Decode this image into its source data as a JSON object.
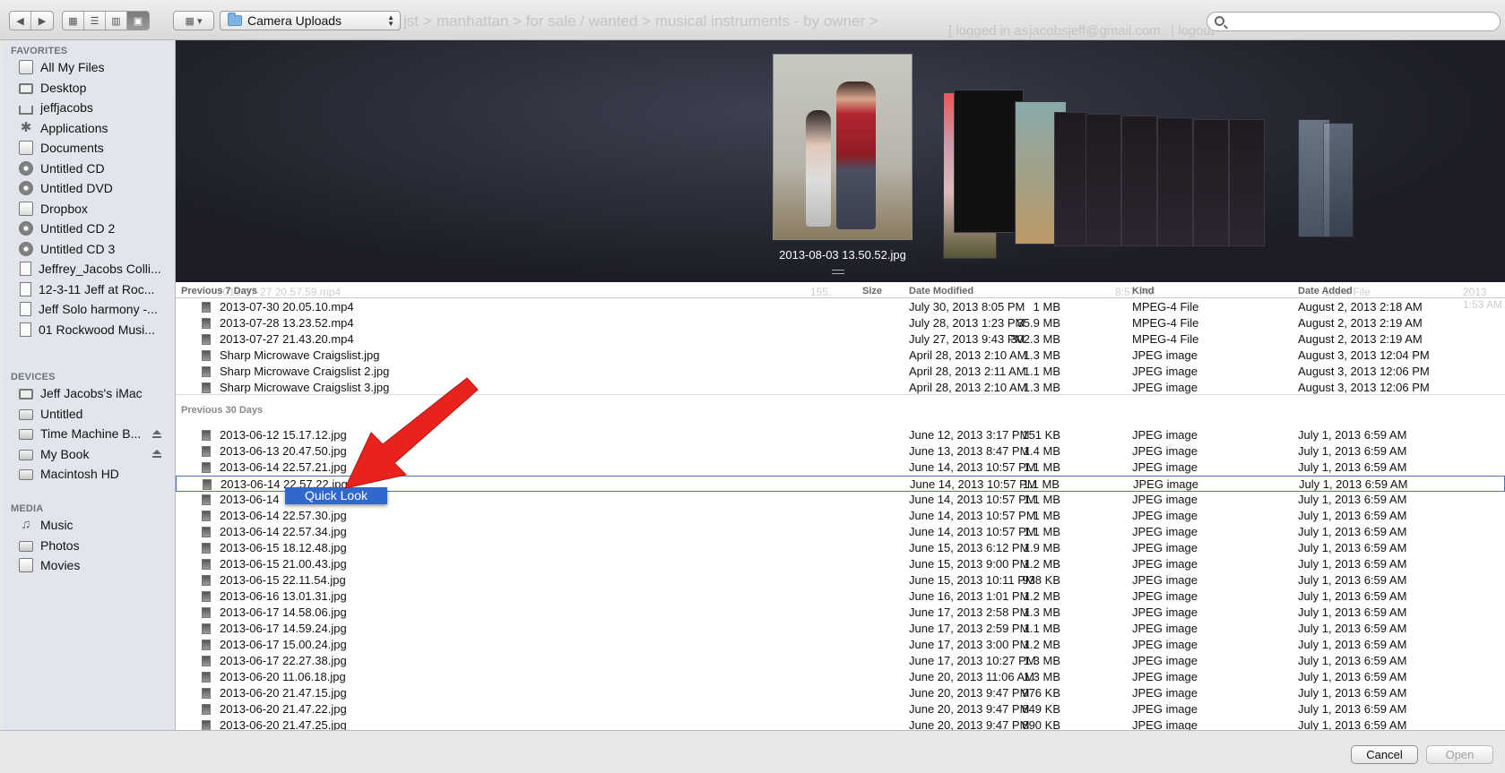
{
  "toolbar": {
    "location": "Camera Uploads",
    "search_placeholder": "",
    "ghost_breadcrumb": "manhattan > for sale / wanted > musical instruments - by owner >",
    "ghost_breadcrumb_head": "jst >",
    "ghost_login": "[ logged in as",
    "ghost_email": "jacobsjeff@gmail.com",
    "ghost_logout": "| logout"
  },
  "sidebar": {
    "favorites_label": "FAVORITES",
    "favorites": [
      {
        "label": "All My Files",
        "icon": "all-files-icon"
      },
      {
        "label": "Desktop",
        "icon": "desktop-icon"
      },
      {
        "label": "jeffjacobs",
        "icon": "home-icon"
      },
      {
        "label": "Applications",
        "icon": "applications-icon"
      },
      {
        "label": "Documents",
        "icon": "documents-icon"
      },
      {
        "label": "Untitled CD",
        "icon": "cd-icon"
      },
      {
        "label": "Untitled DVD",
        "icon": "cd-icon"
      },
      {
        "label": "Dropbox",
        "icon": "folder-icon"
      },
      {
        "label": "Untitled CD 2",
        "icon": "cd-icon"
      },
      {
        "label": "Untitled CD 3",
        "icon": "cd-icon"
      },
      {
        "label": "Jeffrey_Jacobs Colli...",
        "icon": "document-icon"
      },
      {
        "label": "12-3-11 Jeff at Roc...",
        "icon": "document-icon"
      },
      {
        "label": "Jeff Solo harmony -...",
        "icon": "document-icon"
      },
      {
        "label": "01 Rockwood Musi...",
        "icon": "document-icon"
      }
    ],
    "devices_label": "DEVICES",
    "devices": [
      {
        "label": "Jeff Jacobs's iMac",
        "icon": "imac-icon",
        "eject": false
      },
      {
        "label": "Untitled",
        "icon": "drive-icon",
        "eject": false
      },
      {
        "label": "Time Machine B...",
        "icon": "drive-icon",
        "eject": true
      },
      {
        "label": "My Book",
        "icon": "drive-icon",
        "eject": true
      },
      {
        "label": "Macintosh HD",
        "icon": "drive-icon",
        "eject": false
      }
    ],
    "media_label": "MEDIA",
    "media": [
      {
        "label": "Music",
        "icon": "music-icon"
      },
      {
        "label": "Photos",
        "icon": "camera-icon"
      },
      {
        "label": "Movies",
        "icon": "film-icon"
      }
    ]
  },
  "coverflow": {
    "selected_name": "2013-08-03 13.50.52.jpg"
  },
  "columns": {
    "size": "Size",
    "date_modified": "Date Modified",
    "kind": "Kind",
    "date_added": "Date Added"
  },
  "ghost_row": {
    "name": "2013-07-27 20.57.59.mp4",
    "size": "155.",
    "modified": "8:57 PM",
    "kind": "EG-4 File",
    "added": "2013 1:53 AM"
  },
  "groups": [
    {
      "label": "Previous 7 Days",
      "rows": [
        {
          "name": "2013-07-30 20.05.10.mp4",
          "size": "1 MB",
          "modified": "July 30, 2013 8:05 PM",
          "kind": "MPEG-4 File",
          "added": "August 2, 2013 2:18 AM"
        },
        {
          "name": "2013-07-28 13.23.52.mp4",
          "size": "35.9 MB",
          "modified": "July 28, 2013 1:23 PM",
          "kind": "MPEG-4 File",
          "added": "August 2, 2013 2:19 AM"
        },
        {
          "name": "2013-07-27 21.43.20.mp4",
          "size": "302.3 MB",
          "modified": "July 27, 2013 9:43 PM",
          "kind": "MPEG-4 File",
          "added": "August 2, 2013 2:19 AM"
        },
        {
          "name": "Sharp Microwave Craigslist.jpg",
          "size": "1.3 MB",
          "modified": "April 28, 2013 2:10 AM",
          "kind": "JPEG image",
          "added": "August 3, 2013 12:04 PM"
        },
        {
          "name": "Sharp Microwave Craigslist 2.jpg",
          "size": "1.1 MB",
          "modified": "April 28, 2013 2:11 AM",
          "kind": "JPEG image",
          "added": "August 3, 2013 12:06 PM"
        },
        {
          "name": "Sharp Microwave Craigslist 3.jpg",
          "size": "1.3 MB",
          "modified": "April 28, 2013 2:10 AM",
          "kind": "JPEG image",
          "added": "August 3, 2013 12:06 PM"
        }
      ]
    },
    {
      "label": "Previous 30 Days",
      "rows": [
        {
          "name": "2013-06-12 15.17.12.jpg",
          "size": "151 KB",
          "modified": "June 12, 2013 3:17 PM",
          "kind": "JPEG image",
          "added": "July 1, 2013 6:59 AM"
        },
        {
          "name": "2013-06-13 20.47.50.jpg",
          "size": "1.4 MB",
          "modified": "June 13, 2013 8:47 PM",
          "kind": "JPEG image",
          "added": "July 1, 2013 6:59 AM"
        },
        {
          "name": "2013-06-14 22.57.21.jpg",
          "size": "1.1 MB",
          "modified": "June 14, 2013 10:57 PM",
          "kind": "JPEG image",
          "added": "July 1, 2013 6:59 AM"
        },
        {
          "name": "2013-06-14 22.57.22.jpg",
          "size": "1.1 MB",
          "modified": "June 14, 2013 10:57 PM",
          "kind": "JPEG image",
          "added": "July 1, 2013 6:59 AM"
        },
        {
          "name": "2013-06-14",
          "size": "1.1 MB",
          "modified": "June 14, 2013 10:57 PM",
          "kind": "JPEG image",
          "added": "July 1, 2013 6:59 AM"
        },
        {
          "name": "2013-06-14 22.57.30.jpg",
          "size": "1 MB",
          "modified": "June 14, 2013 10:57 PM",
          "kind": "JPEG image",
          "added": "July 1, 2013 6:59 AM"
        },
        {
          "name": "2013-06-14 22.57.34.jpg",
          "size": "1.1 MB",
          "modified": "June 14, 2013 10:57 PM",
          "kind": "JPEG image",
          "added": "July 1, 2013 6:59 AM"
        },
        {
          "name": "2013-06-15 18.12.48.jpg",
          "size": "1.9 MB",
          "modified": "June 15, 2013 6:12 PM",
          "kind": "JPEG image",
          "added": "July 1, 2013 6:59 AM"
        },
        {
          "name": "2013-06-15 21.00.43.jpg",
          "size": "1.2 MB",
          "modified": "June 15, 2013 9:00 PM",
          "kind": "JPEG image",
          "added": "July 1, 2013 6:59 AM"
        },
        {
          "name": "2013-06-15 22.11.54.jpg",
          "size": "938 KB",
          "modified": "June 15, 2013 10:11 PM",
          "kind": "JPEG image",
          "added": "July 1, 2013 6:59 AM"
        },
        {
          "name": "2013-06-16 13.01.31.jpg",
          "size": "1.2 MB",
          "modified": "June 16, 2013 1:01 PM",
          "kind": "JPEG image",
          "added": "July 1, 2013 6:59 AM"
        },
        {
          "name": "2013-06-17 14.58.06.jpg",
          "size": "1.3 MB",
          "modified": "June 17, 2013 2:58 PM",
          "kind": "JPEG image",
          "added": "July 1, 2013 6:59 AM"
        },
        {
          "name": "2013-06-17 14.59.24.jpg",
          "size": "1.1 MB",
          "modified": "June 17, 2013 2:59 PM",
          "kind": "JPEG image",
          "added": "July 1, 2013 6:59 AM"
        },
        {
          "name": "2013-06-17 15.00.24.jpg",
          "size": "1.2 MB",
          "modified": "June 17, 2013 3:00 PM",
          "kind": "JPEG image",
          "added": "July 1, 2013 6:59 AM"
        },
        {
          "name": "2013-06-17 22.27.38.jpg",
          "size": "1.3 MB",
          "modified": "June 17, 2013 10:27 PM",
          "kind": "JPEG image",
          "added": "July 1, 2013 6:59 AM"
        },
        {
          "name": "2013-06-20 11.06.18.jpg",
          "size": "1.3 MB",
          "modified": "June 20, 2013 11:06 AM",
          "kind": "JPEG image",
          "added": "July 1, 2013 6:59 AM"
        },
        {
          "name": "2013-06-20 21.47.15.jpg",
          "size": "976 KB",
          "modified": "June 20, 2013 9:47 PM",
          "kind": "JPEG image",
          "added": "July 1, 2013 6:59 AM"
        },
        {
          "name": "2013-06-20 21.47.22.jpg",
          "size": "849 KB",
          "modified": "June 20, 2013 9:47 PM",
          "kind": "JPEG image",
          "added": "July 1, 2013 6:59 AM"
        },
        {
          "name": "2013-06-20 21.47.25.jpg",
          "size": "890 KB",
          "modified": "June 20, 2013 9:47 PM",
          "kind": "JPEG image",
          "added": "July 1, 2013 6:59 AM"
        }
      ]
    }
  ],
  "context_menu": {
    "item": "Quick Look"
  },
  "buttons": {
    "cancel": "Cancel",
    "open": "Open"
  },
  "colors": {
    "selection": "#3168cc",
    "arrow": "#e8231e"
  }
}
